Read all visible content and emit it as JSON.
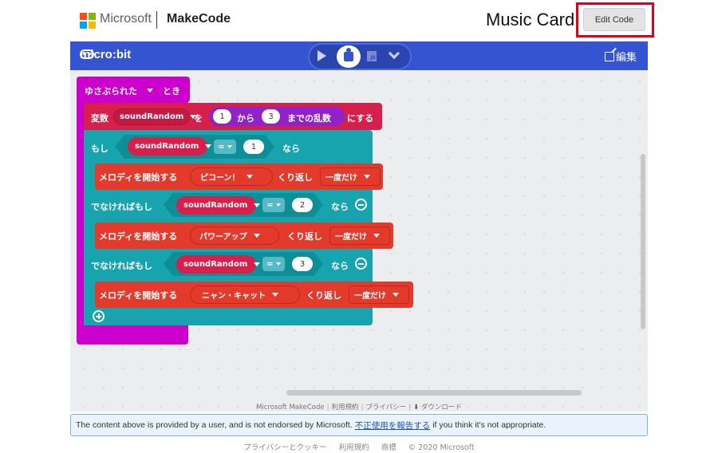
{
  "header": {
    "microsoft_label": "Microsoft",
    "makecode_label": "MakeCode",
    "project_title": "Music Card",
    "edit_code_label": "Edit Code"
  },
  "toolbar": {
    "brand": "micro:bit",
    "edit_label": "編集"
  },
  "blocks": {
    "event": {
      "label": "ゆさぶられた",
      "suffix": "とき"
    },
    "set_var": {
      "prefix": "変数",
      "var": "soundRandom",
      "to": "を",
      "low": "1",
      "from": "から",
      "high": "3",
      "random": "までの乱数",
      "suffix": "にする"
    },
    "if": {
      "label": "もし",
      "var": "soundRandom",
      "op": "=",
      "value": "1",
      "then": "なら"
    },
    "melody1": {
      "label": "メロディを開始する",
      "melody": "ピコーン！",
      "repeat": "くり返し",
      "mode": "一度だけ"
    },
    "elseif1": {
      "label": "でなければもし",
      "var": "soundRandom",
      "op": "=",
      "value": "2",
      "then": "なら"
    },
    "melody2": {
      "label": "メロディを開始する",
      "melody": "パワーアップ",
      "repeat": "くり返し",
      "mode": "一度だけ"
    },
    "elseif2": {
      "label": "でなければもし",
      "var": "soundRandom",
      "op": "=",
      "value": "3",
      "then": "なら"
    },
    "melody3": {
      "label": "メロディを開始する",
      "melody": "ニャン・キャット",
      "repeat": "くり返し",
      "mode": "一度だけ"
    }
  },
  "editor_footer": {
    "items": [
      "Microsoft MakeCode",
      "利用規約",
      "プライバシー"
    ],
    "download": "ダウンロード"
  },
  "notice": {
    "before": "The content above is provided by a user, and is not endorsed by Microsoft.",
    "link": "不正使用を報告する",
    "after": "if you think it's not appropriate."
  },
  "page_footer": {
    "items": [
      "プライバシーとクッキー",
      "利用規約",
      "商標",
      "© 2020 Microsoft"
    ]
  },
  "colors": {
    "event": "#b60cc3",
    "event_hat": "#cc00cc",
    "variables": "#d6204b",
    "math": "#9022c8",
    "logic": "#17a4ae",
    "music": "#e33a2c",
    "toolbar": "#3454d1"
  }
}
